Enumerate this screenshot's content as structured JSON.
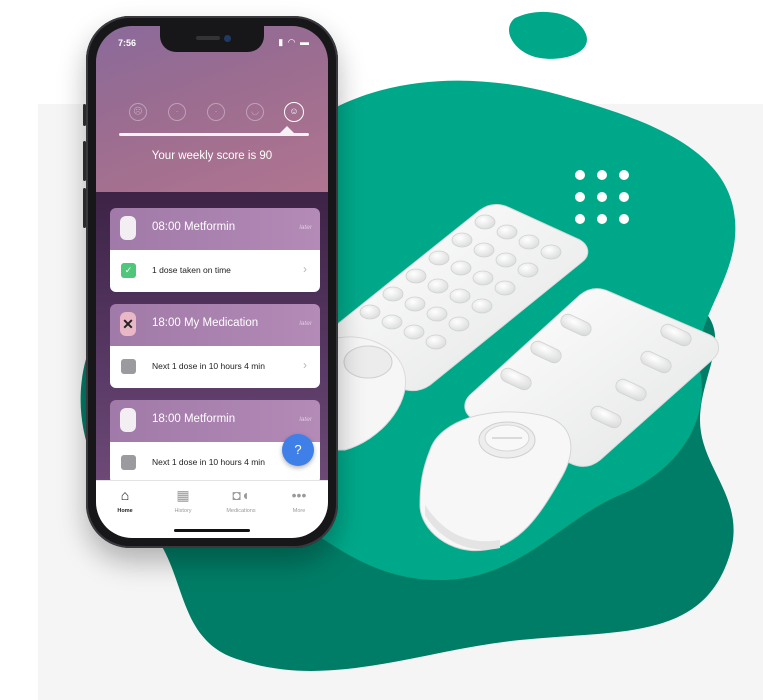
{
  "colors": {
    "teal": "#00a88a",
    "dark_teal": "#007a63",
    "background": "#f5f5f5"
  },
  "status_bar": {
    "time": "7:56"
  },
  "mood_faces": [
    "sad-face-icon",
    "frown-face-icon",
    "neutral-face-icon",
    "smile-face-icon",
    "happy-face-icon"
  ],
  "weekly_score_text": "Your weekly score is 90",
  "cards": [
    {
      "title": "08:00 Metformin",
      "tag": "later",
      "detail": "1 dose taken on time"
    },
    {
      "title": "18:00 My Medication",
      "tag": "later",
      "detail": "Next 1 dose in 10 hours 4 min"
    },
    {
      "title": "18:00 Metformin",
      "tag": "later",
      "detail": "Next 1 dose in 10 hours 4 min"
    }
  ],
  "help_button": "?",
  "tabs": [
    {
      "label": "Home",
      "icon": "home-icon"
    },
    {
      "label": "History",
      "icon": "calendar-icon"
    },
    {
      "label": "Medications",
      "icon": "pills-icon"
    },
    {
      "label": "More",
      "icon": "more-icon"
    }
  ]
}
